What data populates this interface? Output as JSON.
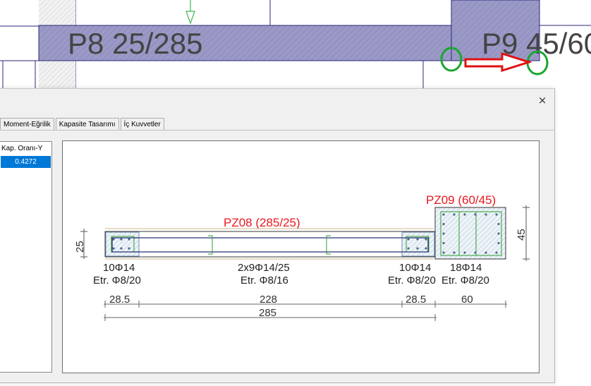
{
  "cad": {
    "wall_p8_label": "P8 25/285",
    "wall_p9_label": "P9 45/60",
    "colors": {
      "wall_fill": "#9b99c6",
      "hatch": "#8a88b8",
      "grid_line": "#2a2a7a",
      "marker_green": "#1aa52e",
      "arrow_red": "#e01010"
    }
  },
  "dialog": {
    "close_icon": "×",
    "tabs": [
      {
        "label": "Moment-Eğrilik",
        "active": false
      },
      {
        "label": "Kapasite Tasarımı",
        "active": false
      },
      {
        "label": "İç Kuvvetler",
        "active": false
      }
    ],
    "grid": {
      "column_header": "Kap. Oranı-Y",
      "selected_value": "0.4272"
    },
    "section": {
      "pz08_title": "PZ08 (285/25)",
      "pz09_title": "PZ09 (60/45)",
      "left_height_dim": "25",
      "right_height_dim": "45",
      "rebar_labels": {
        "left_main": "10Φ14",
        "left_stirrup": "Etr. Φ8/20",
        "web_main": "2x9Φ14/25",
        "web_stirrup": "Etr. Φ8/16",
        "right_main": "10Φ14",
        "right_stirrup": "Etr. Φ8/20",
        "col_main": "18Φ14",
        "col_stirrup": "Etr. Φ8/20"
      },
      "dims": {
        "seg1": "28.5",
        "seg2": "228",
        "seg3": "28.5",
        "seg4": "60",
        "total": "285"
      },
      "colors": {
        "title_red": "#e8181e",
        "rebar_green": "#2e9e2e",
        "section_outline": "#333333"
      }
    }
  }
}
